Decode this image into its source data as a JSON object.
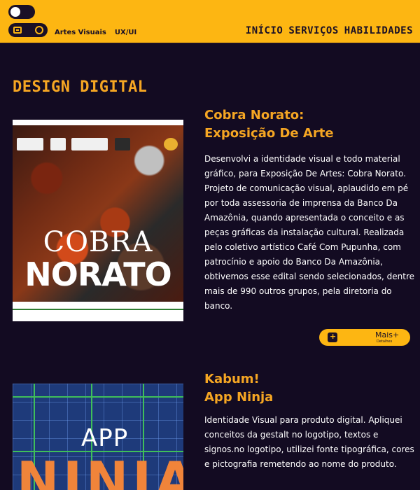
{
  "header": {
    "sub_links": [
      "Artes Visuais",
      "UX/UI"
    ],
    "nav": [
      "INÍCIO",
      "SERVIÇOS",
      "HABILIDADES"
    ]
  },
  "section": {
    "title": "DESIGN DIGITAL"
  },
  "projects": [
    {
      "title_line1": "Cobra Norato:",
      "title_line2": "Exposição De Arte",
      "description": "Desenvolvi a identidade visual e todo material gráfico, para Exposição De Artes: Cobra Norato. Projeto de comunicação visual, aplaudido em pé por toda assessoria de imprensa da Banco Da Amazônia, quando apresentada o conceito e as peças gráficas da instalação cultural. Realizada pelo coletivo artístico Café Com Pupunha, com patrocínio e apoio do Banco Da Amazônia, obtivemos esse edital sendo selecionados, dentre mais de 990 outros grupos, pela diretoria do banco.",
      "poster_word1": "COBRA",
      "poster_word2": "NORATO",
      "more_label": "Mais+",
      "more_sub": "Detalhes"
    },
    {
      "title_line1": "Kabum!",
      "title_line2": "App Ninja",
      "description": "Identidade Visual para produto digital. Apliquei conceitos da gestalt no logotipo, textos e signos.no logotipo, utilizei fonte tipográfica, cores e pictografia remetendo ao nome do produto.",
      "poster_word1": "APP",
      "poster_word2": "NINJA"
    }
  ],
  "colors": {
    "accent": "#fdb612",
    "title": "#f5a623",
    "background": "#130b22"
  }
}
